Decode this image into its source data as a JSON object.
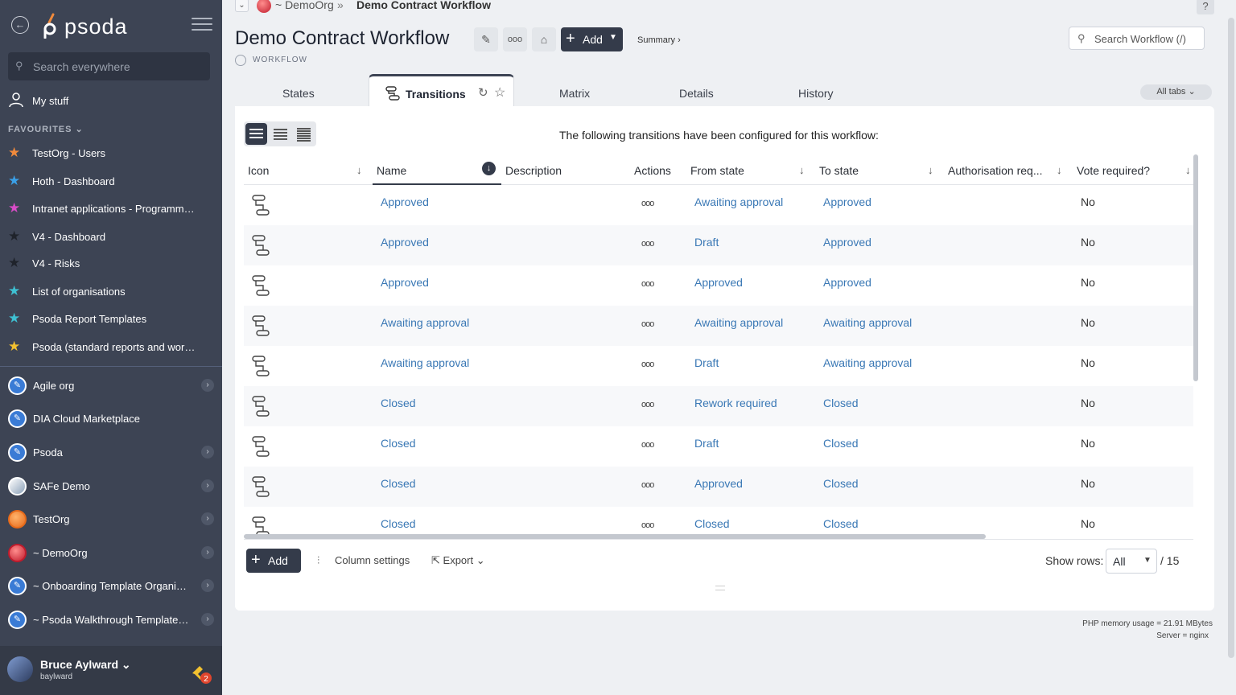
{
  "sidebar": {
    "brand": "psoda",
    "search_placeholder": "Search everywhere",
    "my_stuff": "My stuff",
    "favourites_label": "FAVOURITES",
    "favourites": [
      {
        "label": "TestOrg - Users",
        "color": "#f08a3c"
      },
      {
        "label": "Hoth - Dashboard",
        "color": "#3aa0e8"
      },
      {
        "label": "Intranet applications - Programme...",
        "color": "#d94cc8"
      },
      {
        "label": "V4 - Dashboard",
        "color": "#2b2f36"
      },
      {
        "label": "V4 - Risks",
        "color": "#2b2f36"
      },
      {
        "label": "List of organisations",
        "color": "#3ec1d3"
      },
      {
        "label": "Psoda Report Templates",
        "color": "#3ec1d3"
      },
      {
        "label": "Psoda (standard reports and work...",
        "color": "#f2c130"
      }
    ],
    "orgs": [
      {
        "label": "Agile org",
        "chevron": true,
        "icon": "compass-icon"
      },
      {
        "label": "DIA Cloud Marketplace",
        "chevron": false,
        "icon": "compass-icon"
      },
      {
        "label": "Psoda",
        "chevron": true,
        "icon": "compass-icon"
      },
      {
        "label": "SAFe Demo",
        "chevron": true,
        "icon": "globe-icon"
      },
      {
        "label": "TestOrg",
        "chevron": true,
        "icon": "orange-circle-icon"
      },
      {
        "label": "~ DemoOrg",
        "chevron": true,
        "icon": "red-circle-icon"
      },
      {
        "label": "~ Onboarding Template Organisa...",
        "chevron": true,
        "icon": "compass-icon"
      },
      {
        "label": "~ Psoda Walkthrough Template P...",
        "chevron": true,
        "icon": "compass-icon"
      }
    ],
    "user": {
      "name": "Bruce Aylward",
      "login": "baylward",
      "notifications": "2"
    }
  },
  "breadcrumb": {
    "org": "~ DemoOrg",
    "separator": "»",
    "current": "Demo Contract Workflow"
  },
  "header": {
    "title": "Demo Contract Workflow",
    "type": "WORKFLOW",
    "add_label": "Add",
    "summary_label": "Summary ›",
    "search_placeholder": "Search Workflow (/)",
    "help": "?"
  },
  "tabs": [
    {
      "label": "States",
      "active": false
    },
    {
      "label": "Transitions",
      "active": true
    },
    {
      "label": "Matrix",
      "active": false
    },
    {
      "label": "Details",
      "active": false
    },
    {
      "label": "History",
      "active": false
    }
  ],
  "all_tabs_label": "All tabs",
  "panel": {
    "message": "The following transitions have been configured for this workflow:",
    "columns": [
      "Icon",
      "Name",
      "Description",
      "Actions",
      "From state",
      "To state",
      "Authorisation req...",
      "Vote required?"
    ],
    "rows": [
      {
        "name": "Approved",
        "actions": "ooo",
        "from": "Awaiting approval",
        "to": "Approved",
        "vote": "No"
      },
      {
        "name": "Approved",
        "actions": "ooo",
        "from": "Draft",
        "to": "Approved",
        "vote": "No"
      },
      {
        "name": "Approved",
        "actions": "ooo",
        "from": "Approved",
        "to": "Approved",
        "vote": "No"
      },
      {
        "name": "Awaiting approval",
        "actions": "ooo",
        "from": "Awaiting approval",
        "to": "Awaiting approval",
        "vote": "No"
      },
      {
        "name": "Awaiting approval",
        "actions": "ooo",
        "from": "Draft",
        "to": "Awaiting approval",
        "vote": "No"
      },
      {
        "name": "Closed",
        "actions": "ooo",
        "from": "Rework required",
        "to": "Closed",
        "vote": "No"
      },
      {
        "name": "Closed",
        "actions": "ooo",
        "from": "Draft",
        "to": "Closed",
        "vote": "No"
      },
      {
        "name": "Closed",
        "actions": "ooo",
        "from": "Approved",
        "to": "Closed",
        "vote": "No"
      },
      {
        "name": "Closed",
        "actions": "ooo",
        "from": "Closed",
        "to": "Closed",
        "vote": "No"
      }
    ],
    "footer": {
      "add_label": "Add",
      "column_settings": "Column settings",
      "export": "Export",
      "show_rows_label": "Show rows:",
      "show_rows_value": "All",
      "total": "/ 15"
    }
  },
  "system": {
    "memory": "PHP memory usage = 21.91 MBytes",
    "server": "Server = nginx"
  },
  "colors": {
    "sidebar_bg": "#3d4454",
    "dark_button": "#343b4a",
    "link": "#3a78b5",
    "brand_orange": "#f08a3c"
  }
}
